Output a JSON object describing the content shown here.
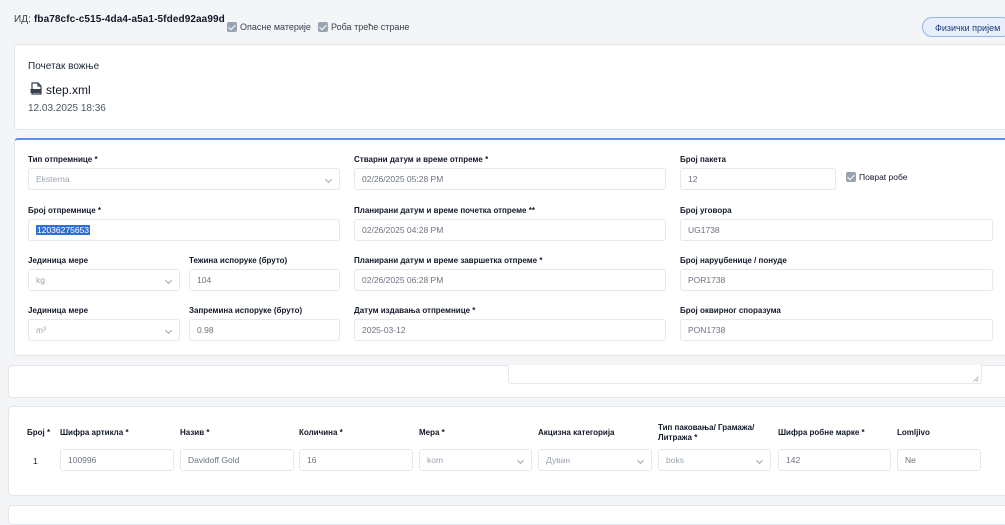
{
  "header": {
    "id_prefix": "ИД:",
    "id_value": "fba78cfc-c515-4da4-a5a1-5fded92aa99d",
    "checkbox_hazardous": "Опасне материје",
    "checkbox_third_party": "Роба трећe стране",
    "physical_receipt_button": "Физички пријем"
  },
  "start_section": {
    "title": "Почетак вожње",
    "file_name": "step.xml",
    "file_date": "12.03.2025 18:36"
  },
  "form": {
    "shipment_type": {
      "label": "Тип отпремнице *",
      "value": "Eksterna"
    },
    "actual_datetime": {
      "label": "Стварни датум и време отпреме *",
      "value": "02/26/2025 05:28 PM"
    },
    "package_count": {
      "label": "Број пакета",
      "value": "12"
    },
    "return_goods": {
      "label": "Повраt робе"
    },
    "shipment_number": {
      "label": "Број отпремнице *",
      "value": "12036275653"
    },
    "planned_start": {
      "label": "Планирани датум и време почетка отпреме **",
      "value": "02/26/2025 04:28 PM"
    },
    "contract_number": {
      "label": "Број уговора",
      "value": "UG1738"
    },
    "unit1": {
      "label": "Јединица мере",
      "value": "kg"
    },
    "weight": {
      "label": "Тежина испоруке (бруто)",
      "value": "104"
    },
    "planned_end": {
      "label": "Планирани датум и време завршетка отпреме *",
      "value": "02/26/2025 06:28 PM"
    },
    "order_number": {
      "label": "Број наруџбенице / понуде",
      "value": "POR1738"
    },
    "unit2": {
      "label": "Јединица мере",
      "value": "m³"
    },
    "volume": {
      "label": "Запремина испоруке (бруто)",
      "value": "0.98"
    },
    "issue_date": {
      "label": "Датум издавања отпремнице *",
      "value": "2025-03-12"
    },
    "framework_number": {
      "label": "Број оквирног споразума",
      "value": "PON1738"
    }
  },
  "items_table": {
    "headers": {
      "number": "Број *",
      "article_code": "Шифра артикла *",
      "name": "Назив *",
      "quantity": "Количина *",
      "unit": "Мера *",
      "excise": "Акцизна категорија",
      "packaging_line1": "Тип паковања/ Грамажа/",
      "packaging_line2": "Литража *",
      "brand_code": "Шифра робне марке *",
      "fragile": "Lomljivo"
    },
    "row": {
      "number": "1",
      "article_code": "100996",
      "name": "Davidoff Gold",
      "quantity": "16",
      "unit": "kom",
      "excise": "Дуван",
      "packaging": "boks",
      "brand_code": "142",
      "fragile": "Ne"
    }
  },
  "colors": {
    "accent": "#5b8def",
    "selection": "#2f6fd6",
    "background": "#f4f5f7"
  }
}
